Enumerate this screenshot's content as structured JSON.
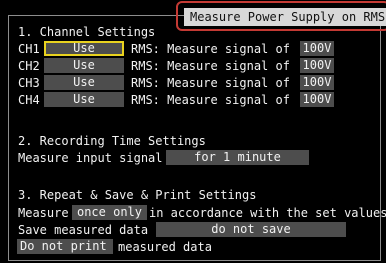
{
  "header": {
    "mode_title": "Measure Power Supply on RMS"
  },
  "channel_settings": {
    "heading": "1. Channel Settings",
    "rms_label": "RMS: Measure signal of",
    "channels": [
      {
        "name": "CH1",
        "use": "Use",
        "voltage": "100V",
        "selected": true
      },
      {
        "name": "CH2",
        "use": "Use",
        "voltage": "100V",
        "selected": false
      },
      {
        "name": "CH3",
        "use": "Use",
        "voltage": "100V",
        "selected": false
      },
      {
        "name": "CH4",
        "use": "Use",
        "voltage": "100V",
        "selected": false
      }
    ]
  },
  "recording_time": {
    "heading": "2. Recording Time Settings",
    "label": "Measure input signal",
    "value": "for 1 minute"
  },
  "repeat_save_print": {
    "heading": "3. Repeat & Save & Print Settings",
    "measure_prefix": "Measure",
    "repeat_value": "once only",
    "measure_suffix": "in accordance with the set values",
    "save_label": "Save measured data",
    "save_value": "do not save",
    "print_value": "Do not print",
    "print_suffix": "measured data"
  },
  "colors": {
    "background": "#000000",
    "field": "#4d4d4d",
    "selected_border": "#e9d21f",
    "highlight_border": "#c43a34",
    "title_bar": "#d8d8d8",
    "text": "#f2f2f2"
  }
}
